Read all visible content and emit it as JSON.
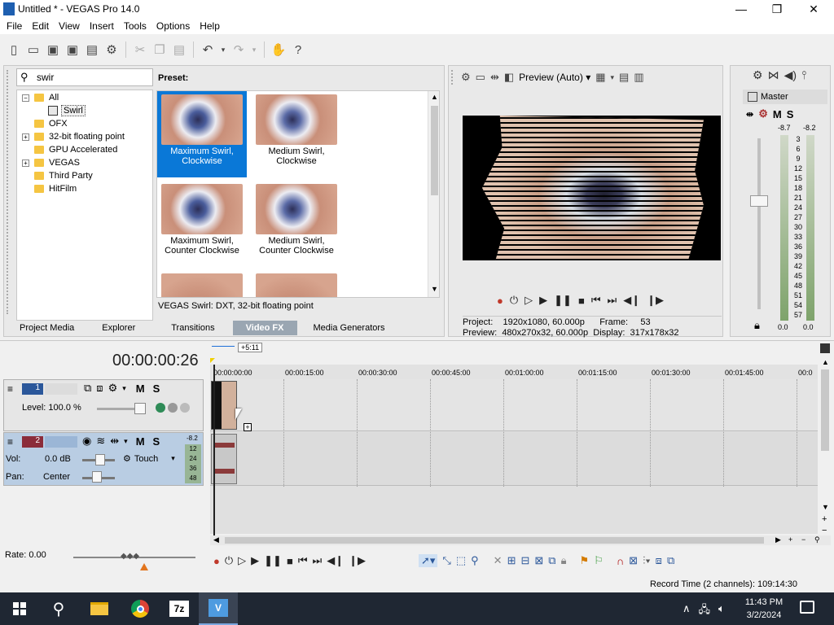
{
  "window": {
    "title": "Untitled * - VEGAS Pro 14.0",
    "minimize": "—",
    "maximize": "❐",
    "close": "✕"
  },
  "menu": [
    "File",
    "Edit",
    "View",
    "Insert",
    "Tools",
    "Options",
    "Help"
  ],
  "explorer": {
    "search_value": "swir",
    "tree": [
      {
        "label": "All",
        "level": 0,
        "expander": "−"
      },
      {
        "label": "Swirl",
        "level": 1,
        "expander": ""
      },
      {
        "label": "OFX",
        "level": 0,
        "expander": ""
      },
      {
        "label": "32-bit floating point",
        "level": 0,
        "expander": "+"
      },
      {
        "label": "GPU Accelerated",
        "level": 0,
        "expander": ""
      },
      {
        "label": "VEGAS",
        "level": 0,
        "expander": "+"
      },
      {
        "label": "Third Party",
        "level": 0,
        "expander": ""
      },
      {
        "label": "HitFilm",
        "level": 0,
        "expander": ""
      }
    ],
    "preset_label": "Preset:",
    "presets": [
      "Maximum Swirl, Clockwise",
      "Medium Swirl, Clockwise",
      "Maximum Swirl, Counter Clockwise",
      "Medium Swirl, Counter Clockwise",
      "",
      ""
    ],
    "status": "VEGAS Swirl: DXT, 32-bit floating point",
    "tabs": [
      "Project Media",
      "Explorer",
      "Transitions",
      "Video FX",
      "Media Generators"
    ],
    "active_tab": "Video FX"
  },
  "preview": {
    "quality": "Preview (Auto)",
    "project_label": "Project:",
    "project_value": "1920x1080, 60.000p",
    "preview_label": "Preview:",
    "preview_value": "480x270x32, 60.000p",
    "frame_label": "Frame:",
    "frame_value": "53",
    "display_label": "Display:",
    "display_value": "317x178x32"
  },
  "master": {
    "label": "Master",
    "m": "M",
    "s": "S",
    "peak_left": "-8.7",
    "peak_right": "-8.2",
    "scale": [
      "3",
      "6",
      "9",
      "12",
      "15",
      "18",
      "21",
      "24",
      "27",
      "30",
      "33",
      "36",
      "39",
      "42",
      "45",
      "48",
      "51",
      "54",
      "57"
    ],
    "bottom_left": "0.0",
    "bottom_right": "0.0"
  },
  "timeline": {
    "timecode": "00:00:00:26",
    "marker": "+5:11",
    "ruler": [
      "00:00:00:00",
      "00:00:15:00",
      "00:00:30:00",
      "00:00:45:00",
      "00:01:00:00",
      "00:01:15:00",
      "00:01:30:00",
      "00:01:45:00",
      "00:0"
    ],
    "video_track": {
      "number": "1",
      "m": "M",
      "s": "S",
      "level": "Level: 100.0 %"
    },
    "audio_track": {
      "number": "2",
      "m": "M",
      "s": "S",
      "vol_label": "Vol:",
      "vol_value": "0.0 dB",
      "pan_label": "Pan:",
      "pan_value": "Center",
      "automation": "Touch",
      "meter_top": "-8.2",
      "meter_values": [
        "12",
        "24",
        "36",
        "48"
      ]
    },
    "rate": "Rate: 0.00",
    "record_time": "Record Time (2 channels): 109:14:30"
  },
  "taskbar": {
    "time": "11:43 PM",
    "date": "3/2/2024"
  }
}
